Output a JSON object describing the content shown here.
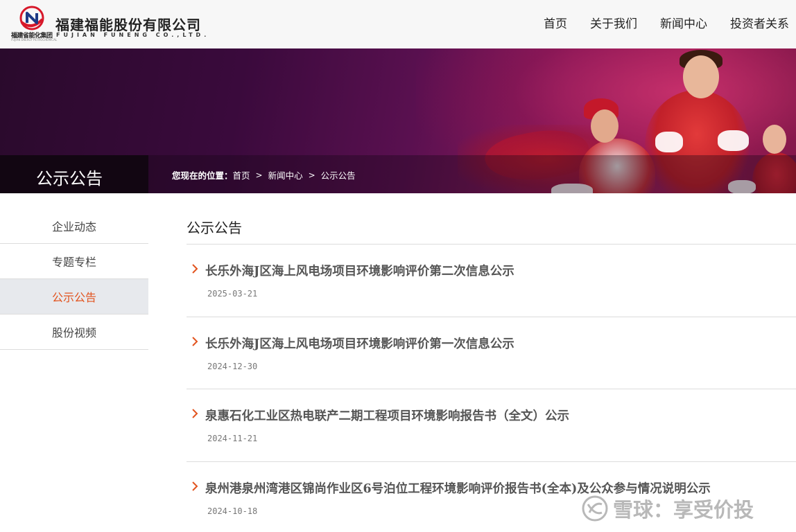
{
  "header": {
    "logo_subtitle": "福建省能化集团",
    "logo_subtitle_en": "FUJIAN ENERGY PETROCHEMICAL",
    "company_name_cn": "福建福能股份有限公司",
    "company_name_en": "FUJIAN FUNENG CO.,LTD.",
    "logo_colors": {
      "red": "#d7182a",
      "navy": "#1d3a86"
    },
    "nav": [
      {
        "label": "首页"
      },
      {
        "label": "关于我们"
      },
      {
        "label": "新闻中心"
      },
      {
        "label": "投资者关系"
      }
    ]
  },
  "banner": {
    "section_title": "公示公告",
    "breadcrumb_label": "您现在的位置：",
    "breadcrumb": [
      "首页",
      "新闻中心",
      "公示公告"
    ],
    "breadcrumb_separator": ">"
  },
  "sidebar": {
    "items": [
      {
        "label": "企业动态",
        "active": false
      },
      {
        "label": "专题专栏",
        "active": false
      },
      {
        "label": "公示公告",
        "active": true
      },
      {
        "label": "股份视频",
        "active": false
      }
    ],
    "active_color": "#e2531e"
  },
  "main": {
    "title": "公示公告",
    "chevron_color": "#e2531e",
    "news": [
      {
        "title": "长乐外海J区海上风电场项目环境影响评价第二次信息公示",
        "date": "2025-03-21"
      },
      {
        "title": "长乐外海J区海上风电场项目环境影响评价第一次信息公示",
        "date": "2024-12-30"
      },
      {
        "title": "泉惠石化工业区热电联产二期工程项目环境影响报告书（全文）公示",
        "date": "2024-11-21"
      },
      {
        "title": "泉州港泉州湾港区锦尚作业区6号泊位工程环境影响评价报告书(全本)及公众参与情况说明公示",
        "date": "2024-10-18"
      }
    ]
  },
  "watermark": {
    "text": "雪球：享受价投"
  }
}
